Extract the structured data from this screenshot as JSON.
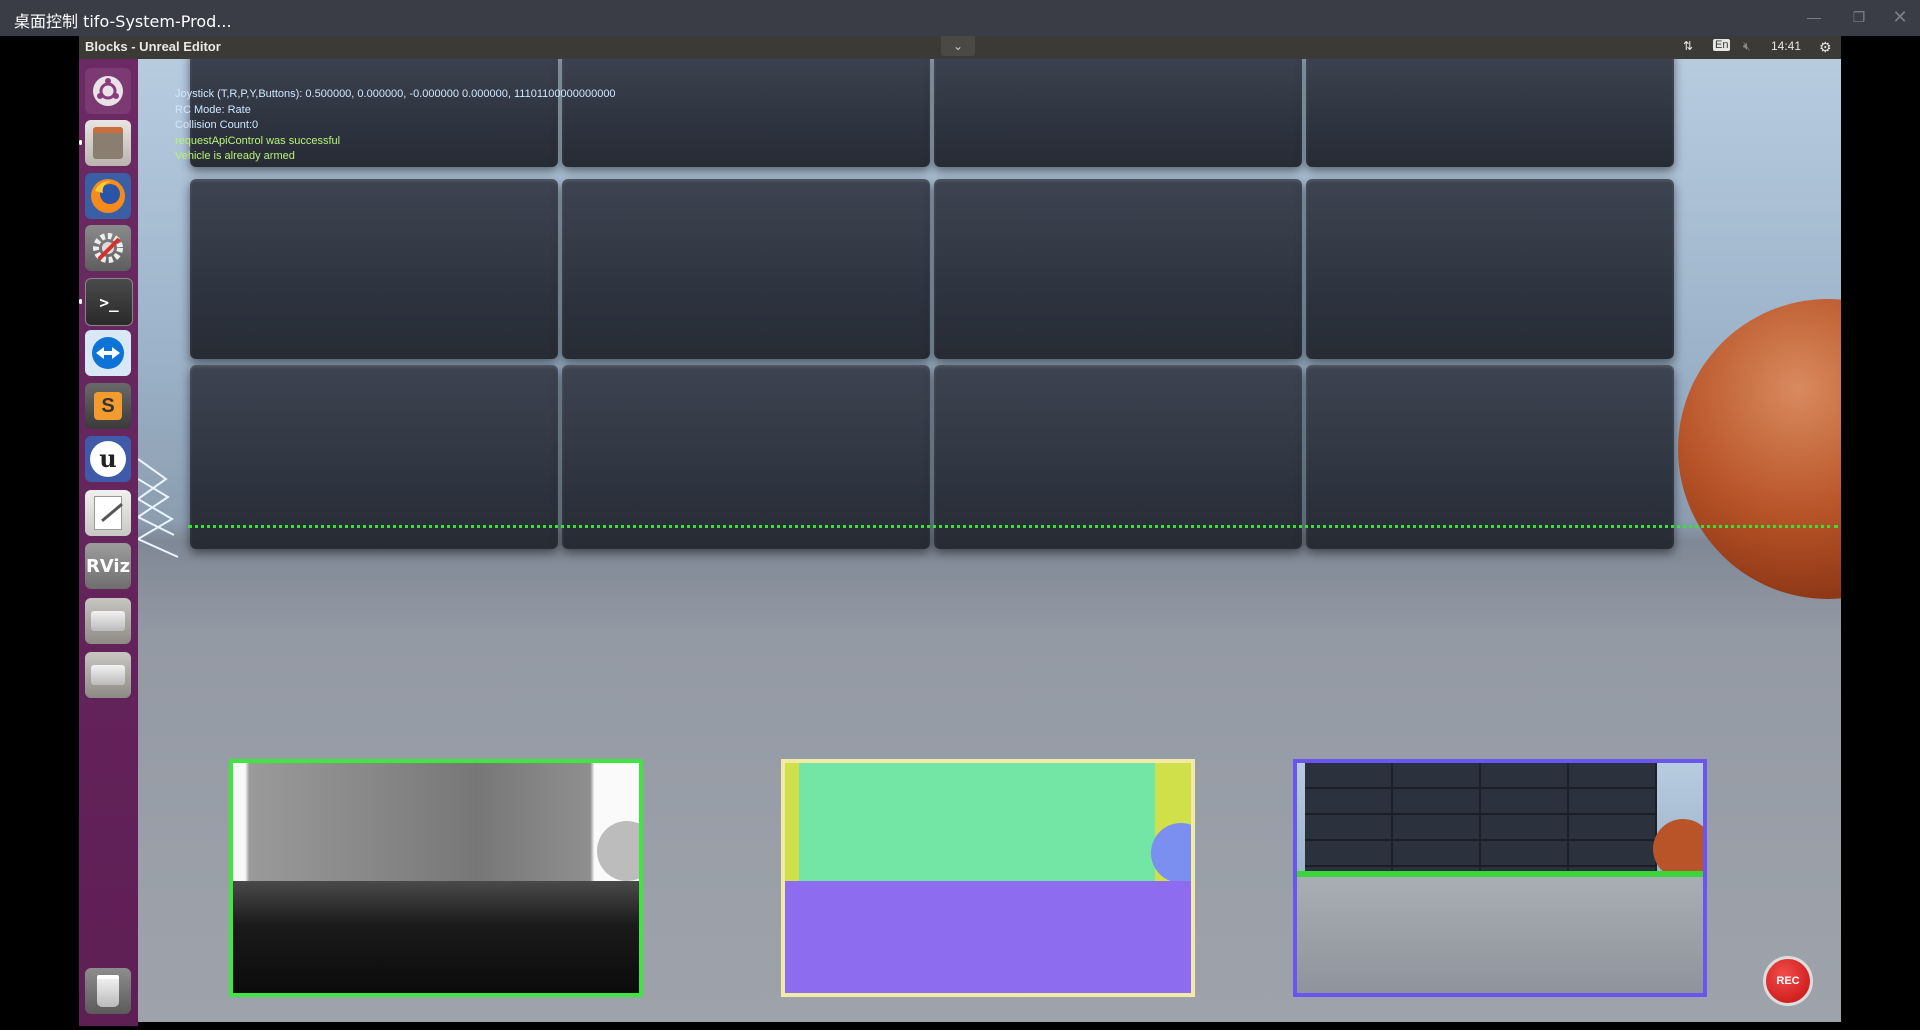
{
  "outer_window": {
    "title": "桌面控制 tifo-System-Prod..."
  },
  "top_panel": {
    "app_title": "Blocks - Unreal Editor",
    "dropdown_icon": "chevron-down-icon",
    "keyboard_layout": "En",
    "clock": "14:41"
  },
  "launcher": {
    "items": [
      {
        "name": "ubuntu-dash",
        "icon": "ubuntu-logo-icon"
      },
      {
        "name": "files",
        "icon": "file-cabinet-icon"
      },
      {
        "name": "firefox",
        "icon": "firefox-icon"
      },
      {
        "name": "system-settings",
        "icon": "settings-gear-icon"
      },
      {
        "name": "terminal",
        "icon": "terminal-icon"
      },
      {
        "name": "teamviewer",
        "icon": "teamviewer-icon"
      },
      {
        "name": "sublime-text",
        "icon": "sublime-icon"
      },
      {
        "name": "unreal-editor",
        "icon": "unreal-icon"
      },
      {
        "name": "text-editor",
        "icon": "text-editor-icon"
      },
      {
        "name": "rviz",
        "icon": "rviz-icon",
        "label": "RViz"
      },
      {
        "name": "drive-1",
        "icon": "drive-icon"
      },
      {
        "name": "drive-2",
        "icon": "drive-icon"
      },
      {
        "name": "trash",
        "icon": "trash-icon"
      }
    ]
  },
  "hud": {
    "lines": [
      "Joystick (T,R,P,Y,Buttons): 0.500000, 0.000000, -0.000000 0.000000, 11101100000000000",
      "RC Mode: Rate",
      "Collision Count:0",
      "requestApiControl was successful",
      "Vehicle is already armed"
    ],
    "colors": [
      "#cfe8ff",
      "#cfe8ff",
      "#cfe8ff",
      "#b9f27a",
      "#b9f27a"
    ]
  },
  "subwindows": [
    {
      "name": "depth",
      "border": "#3fe63f"
    },
    {
      "name": "segmentation",
      "border": "#f3eaa8"
    },
    {
      "name": "scene",
      "border": "#6a55f0"
    }
  ],
  "record_button": {
    "label": "REC"
  }
}
